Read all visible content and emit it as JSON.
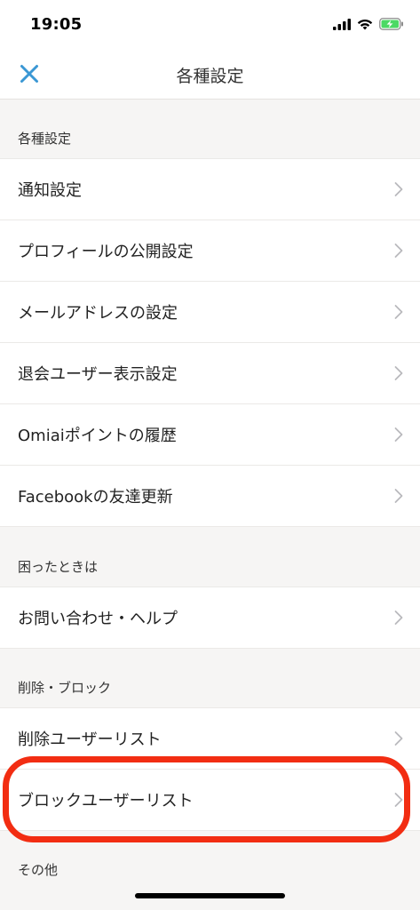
{
  "status_bar": {
    "time": "19:05"
  },
  "nav": {
    "title": "各種設定",
    "close_icon": "close-icon"
  },
  "sections": [
    {
      "header": "各種設定",
      "items": [
        "通知設定",
        "プロフィールの公開設定",
        "メールアドレスの設定",
        "退会ユーザー表示設定",
        "Omiaiポイントの履歴",
        "Facebookの友達更新"
      ]
    },
    {
      "header": "困ったときは",
      "items": [
        "お問い合わせ・ヘルプ"
      ]
    },
    {
      "header": "削除・ブロック",
      "items": [
        "削除ユーザーリスト",
        "ブロックユーザーリスト"
      ]
    },
    {
      "header": "その他",
      "items": []
    }
  ],
  "colors": {
    "accent": "#3a97d4",
    "highlight": "#f22d12",
    "background": "#f6f5f4",
    "battery": "#4cd964"
  }
}
